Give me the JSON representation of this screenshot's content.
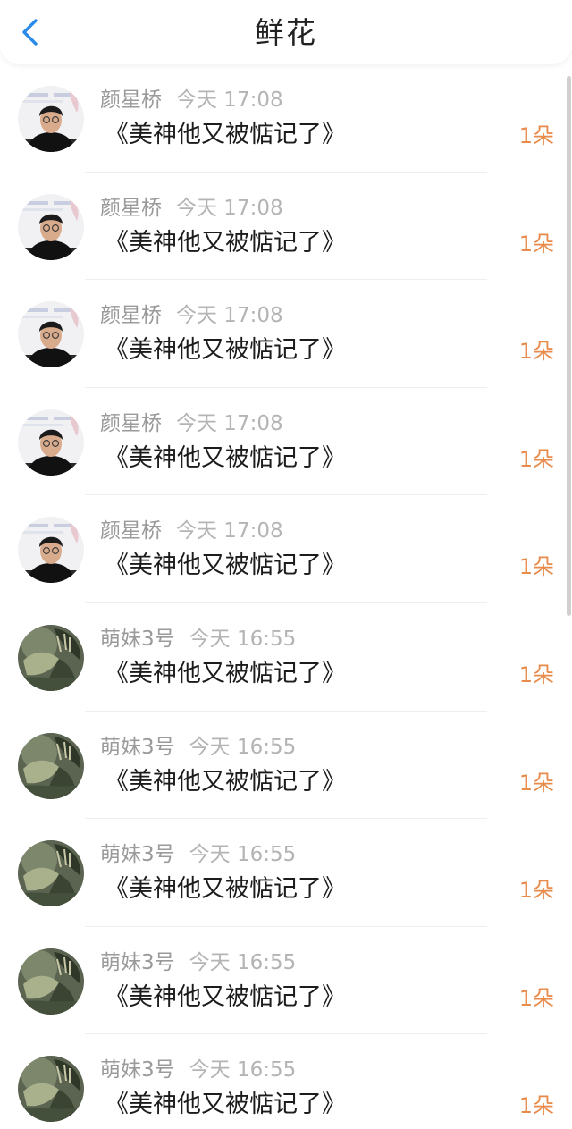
{
  "header": {
    "title": "鲜花",
    "back_icon": "chevron-left-icon",
    "accent_color": "#2b8ae8"
  },
  "list": {
    "count_color": "#e88a4a",
    "items": [
      {
        "name": "颜星桥",
        "time": "今天 17:08",
        "book": "《美神他又被惦记了》",
        "count": "1朵",
        "avatar": "user-avatar-man"
      },
      {
        "name": "颜星桥",
        "time": "今天 17:08",
        "book": "《美神他又被惦记了》",
        "count": "1朵",
        "avatar": "user-avatar-man"
      },
      {
        "name": "颜星桥",
        "time": "今天 17:08",
        "book": "《美神他又被惦记了》",
        "count": "1朵",
        "avatar": "user-avatar-man"
      },
      {
        "name": "颜星桥",
        "time": "今天 17:08",
        "book": "《美神他又被惦记了》",
        "count": "1朵",
        "avatar": "user-avatar-man"
      },
      {
        "name": "颜星桥",
        "time": "今天 17:08",
        "book": "《美神他又被惦记了》",
        "count": "1朵",
        "avatar": "user-avatar-man"
      },
      {
        "name": "萌妹3号",
        "time": "今天 16:55",
        "book": "《美神他又被惦记了》",
        "count": "1朵",
        "avatar": "user-avatar-illustration"
      },
      {
        "name": "萌妹3号",
        "time": "今天 16:55",
        "book": "《美神他又被惦记了》",
        "count": "1朵",
        "avatar": "user-avatar-illustration"
      },
      {
        "name": "萌妹3号",
        "time": "今天 16:55",
        "book": "《美神他又被惦记了》",
        "count": "1朵",
        "avatar": "user-avatar-illustration"
      },
      {
        "name": "萌妹3号",
        "time": "今天 16:55",
        "book": "《美神他又被惦记了》",
        "count": "1朵",
        "avatar": "user-avatar-illustration"
      },
      {
        "name": "萌妹3号",
        "time": "今天 16:55",
        "book": "《美神他又被惦记了》",
        "count": "1朵",
        "avatar": "user-avatar-illustration"
      }
    ]
  }
}
